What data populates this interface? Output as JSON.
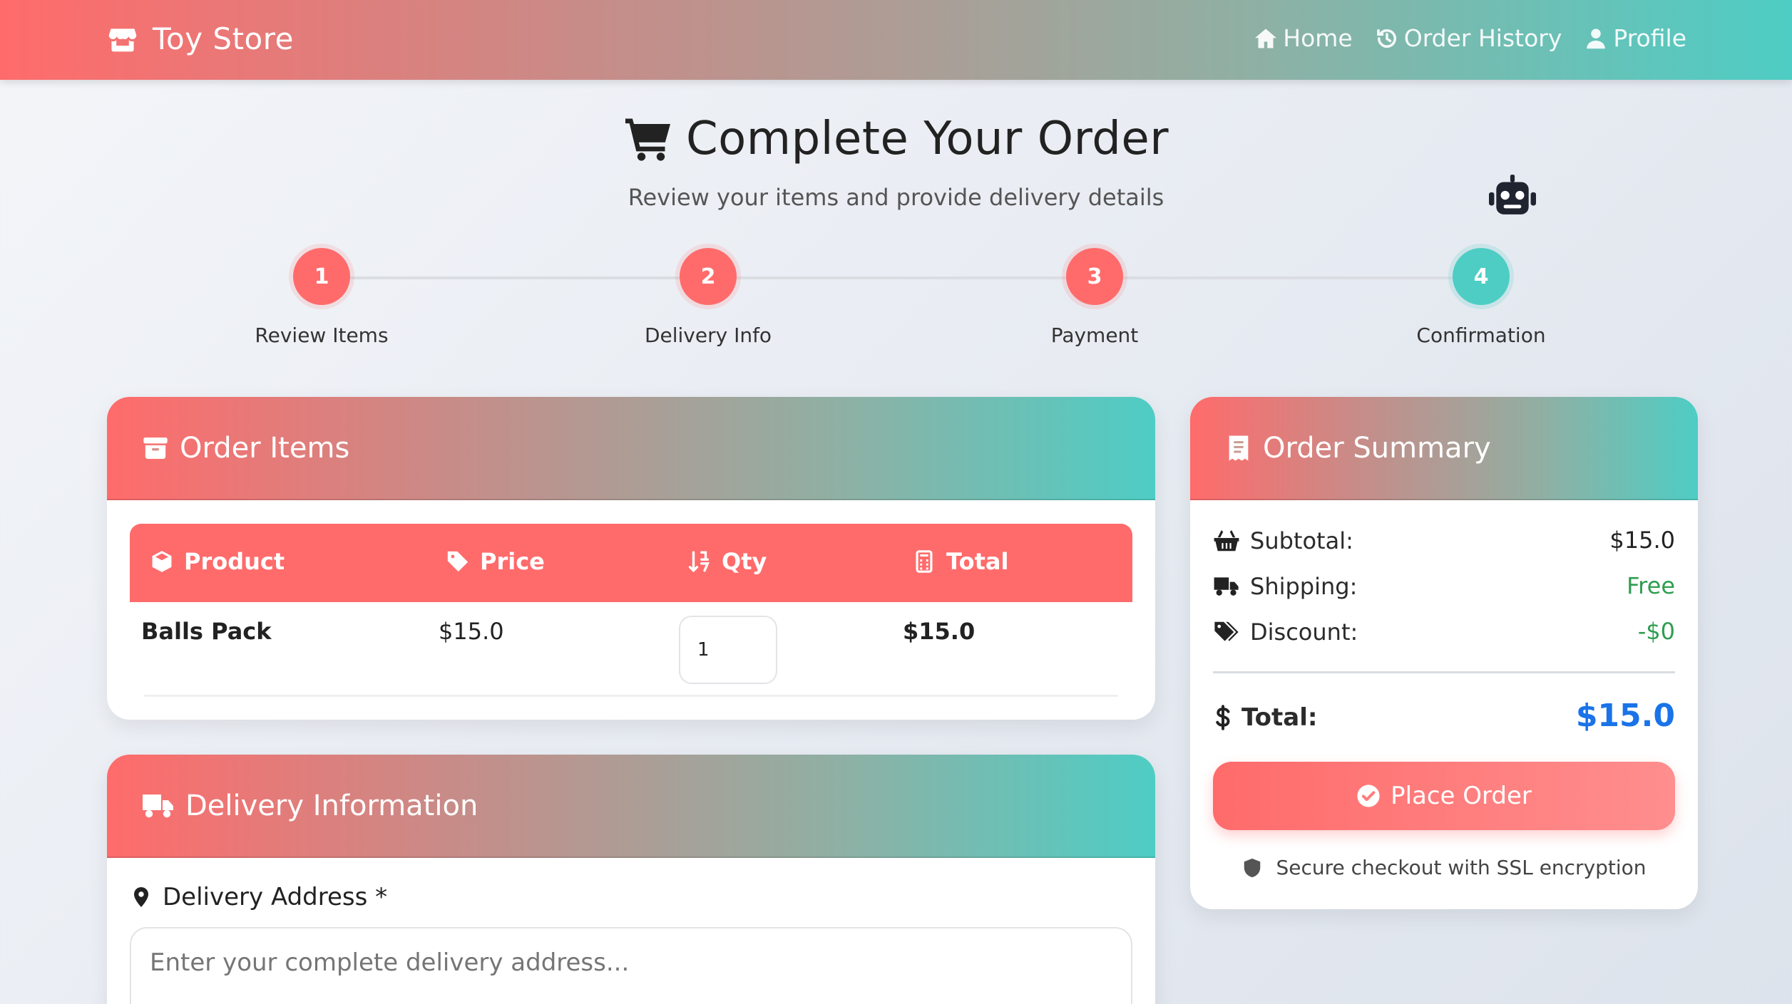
{
  "nav": {
    "brand": "Toy Store",
    "links": [
      {
        "label": "Home",
        "icon": "home-icon"
      },
      {
        "label": "Order History",
        "icon": "history-icon"
      },
      {
        "label": "Profile",
        "icon": "user-icon"
      }
    ]
  },
  "page": {
    "title": "Complete Your Order",
    "subtitle": "Review your items and provide delivery details"
  },
  "steps": [
    {
      "number": "1",
      "label": "Review Items"
    },
    {
      "number": "2",
      "label": "Delivery Info"
    },
    {
      "number": "3",
      "label": "Payment"
    },
    {
      "number": "4",
      "label": "Confirmation",
      "active": true
    }
  ],
  "order_items": {
    "title": "Order Items",
    "columns": [
      "Product",
      "Price",
      "Qty",
      "Total"
    ],
    "rows": [
      {
        "product": "Balls Pack",
        "price": "$15.0",
        "qty": "1",
        "total": "$15.0"
      }
    ]
  },
  "delivery": {
    "title": "Delivery Information",
    "address_label": "Delivery Address *",
    "address_placeholder": "Enter your complete delivery address..."
  },
  "summary": {
    "title": "Order Summary",
    "subtotal_label": "Subtotal:",
    "subtotal_value": "$15.0",
    "shipping_label": "Shipping:",
    "shipping_value": "Free",
    "discount_label": "Discount:",
    "discount_value": "-$0",
    "total_label": "Total:",
    "total_value": "$15.0",
    "place_order": "Place Order",
    "secure_note": "Secure checkout with SSL encryption"
  },
  "colors": {
    "coral": "#ff6b6b",
    "teal": "#4ecdc4",
    "total_blue": "#1a73e8",
    "green": "#2e9e4f"
  }
}
